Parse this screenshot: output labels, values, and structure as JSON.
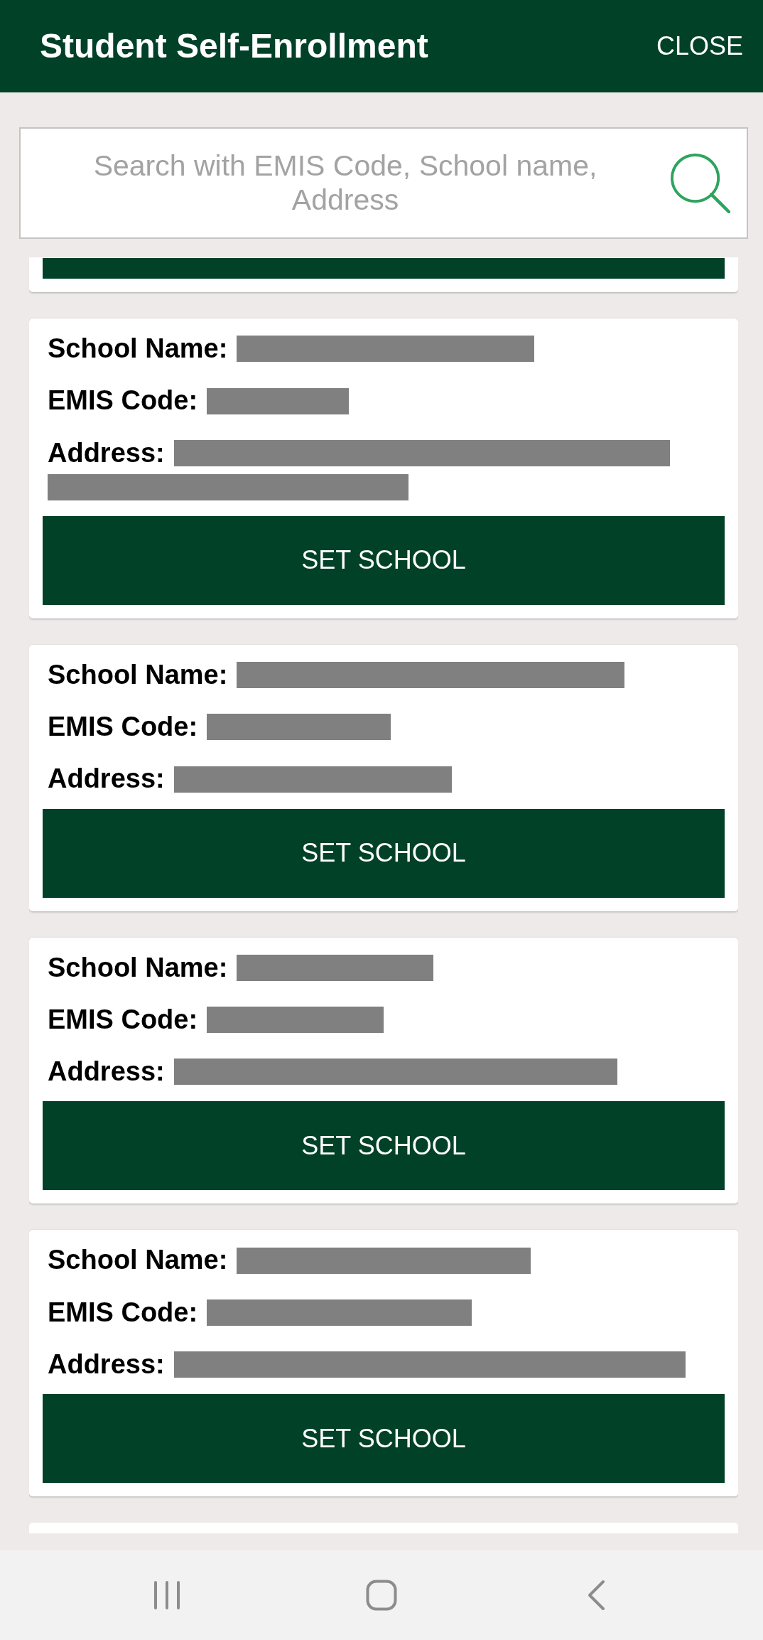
{
  "header": {
    "title": "Student Self-Enrollment",
    "close_label": "CLOSE"
  },
  "search": {
    "placeholder": "Search with EMIS Code, School name, Address"
  },
  "results": [
    {
      "kind": "clipped_top"
    },
    {
      "kind": "school",
      "fields": [
        {
          "label": "School Name:",
          "redacted": true
        },
        {
          "label": "EMIS Code:",
          "redacted": true
        },
        {
          "label": "Address:",
          "redacted": true
        }
      ],
      "button": "SET SCHOOL"
    },
    {
      "kind": "school",
      "fields": [
        {
          "label": "School Name:",
          "redacted": true
        },
        {
          "label": "EMIS Code:",
          "redacted": true
        },
        {
          "label": "Address:",
          "redacted": true
        }
      ],
      "button": "SET SCHOOL"
    },
    {
      "kind": "school",
      "fields": [
        {
          "label": "School Name:",
          "redacted": true
        },
        {
          "label": "EMIS Code:",
          "redacted": true
        },
        {
          "label": "Address:",
          "redacted": true
        }
      ],
      "button": "SET SCHOOL"
    },
    {
      "kind": "school",
      "fields": [
        {
          "label": "School Name:",
          "redacted": true
        },
        {
          "label": "EMIS Code:",
          "redacted": true
        },
        {
          "label": "Address:",
          "redacted": true
        }
      ],
      "button": "SET SCHOOL"
    },
    {
      "kind": "clipped_bottom"
    }
  ]
}
